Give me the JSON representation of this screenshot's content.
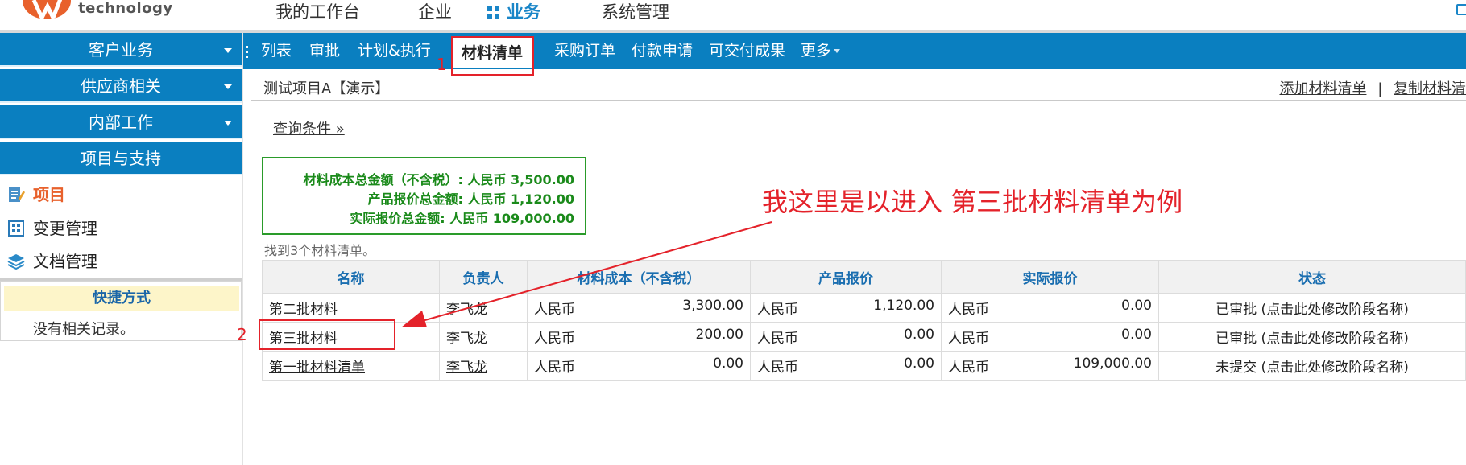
{
  "brand": {
    "logo_text": "technology",
    "brand_color": "#e8612c"
  },
  "top_nav": [
    "我的工作台",
    "企业",
    "业务",
    "系统管理"
  ],
  "top_nav_active": "业务",
  "sidebar": {
    "headers": [
      "客户业务",
      "供应商相关",
      "内部工作",
      "项目与支持"
    ],
    "items": [
      {
        "label": "项目",
        "icon": "project-icon",
        "active": true
      },
      {
        "label": "变更管理",
        "icon": "change-icon"
      },
      {
        "label": "文档管理",
        "icon": "layers-icon"
      }
    ],
    "quick": {
      "title": "快捷方式",
      "empty": "没有相关记录。"
    }
  },
  "tabs": [
    "列表",
    "审批",
    "计划&执行",
    "材料清单",
    "采购订单",
    "付款申请",
    "可交付成果",
    "更多"
  ],
  "active_tab": "材料清单",
  "project": {
    "name": "测试项目A【演示】"
  },
  "actions": {
    "add": "添加材料清单",
    "sep": "|",
    "copy": "复制材料清"
  },
  "query_link": "查询条件 »",
  "summary": {
    "line1": "材料成本总金额（不含税）: 人民币 3,500.00",
    "line2": "产品报价总金额: 人民币 1,120.00",
    "line3": "实际报价总金额: 人民币 109,000.00"
  },
  "found_text": "找到3个材料清单。",
  "table": {
    "headers": [
      "名称",
      "负责人",
      "材料成本（不含税）",
      "产品报价",
      "实际报价",
      "状态"
    ],
    "rows": [
      {
        "name": "第二批材料",
        "owner": "李飞龙",
        "cost_cur": "人民币",
        "cost": "3,300.00",
        "quote_cur": "人民币",
        "quote": "1,120.00",
        "actual_cur": "人民币",
        "actual": "0.00",
        "status": "已审批 (点击此处修改阶段名称)"
      },
      {
        "name": "第三批材料",
        "owner": "李飞龙",
        "cost_cur": "人民币",
        "cost": "200.00",
        "quote_cur": "人民币",
        "quote": "0.00",
        "actual_cur": "人民币",
        "actual": "0.00",
        "status": "已审批 (点击此处修改阶段名称)"
      },
      {
        "name": "第一批材料清单",
        "owner": "李飞龙",
        "cost_cur": "人民币",
        "cost": "0.00",
        "quote_cur": "人民币",
        "quote": "0.00",
        "actual_cur": "人民币",
        "actual": "109,000.00",
        "status": "未提交 (点击此处修改阶段名称)"
      }
    ]
  },
  "annotations": {
    "marker1": "1",
    "marker2": "2",
    "note": "我这里是以进入 第三批材料清单为例",
    "color": "#e4222a"
  },
  "colors": {
    "primary": "#0a7fc0",
    "summary_green": "#1a8a1a",
    "header_text": "#1a6eb0"
  }
}
